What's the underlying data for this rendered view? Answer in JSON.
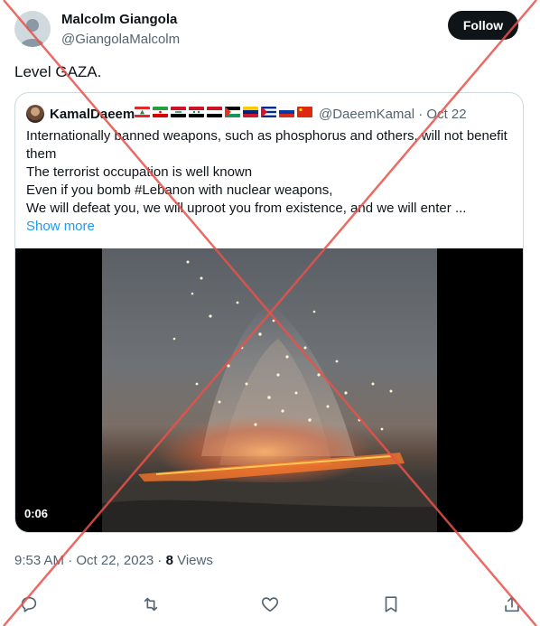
{
  "author": {
    "name": "Malcolm Giangola",
    "handle": "@GiangolaMalcolm"
  },
  "follow_label": "Follow",
  "tweet_text": "Level GAZA.",
  "quote": {
    "name": "KamalDaeem",
    "flags": [
      "lebanon",
      "iran",
      "iraq",
      "syria",
      "yemen",
      "palestine",
      "venezuela",
      "cuba",
      "russia",
      "china"
    ],
    "handle_date": "@DaeemKamal · Oct 22",
    "lines": [
      "Internationally banned weapons, such as phosphorus and others, will not benefit",
      "them",
      "The terrorist occupation is well known",
      "Even if you  bomb #Lebanon with nuclear weapons,",
      "We will defeat you, we will uproot you from existence, and we will enter ..."
    ],
    "show_more": "Show more",
    "video_duration": "0:06"
  },
  "meta": {
    "time_date": "9:53 AM · Oct 22, 2023 · ",
    "views_count": "8",
    "views_label": " Views"
  },
  "actions": [
    "reply-icon",
    "retweet-icon",
    "like-icon",
    "bookmark-icon",
    "share-icon"
  ],
  "colors": {
    "accent": "#1d9bf0",
    "watermark": "#e8524a"
  }
}
